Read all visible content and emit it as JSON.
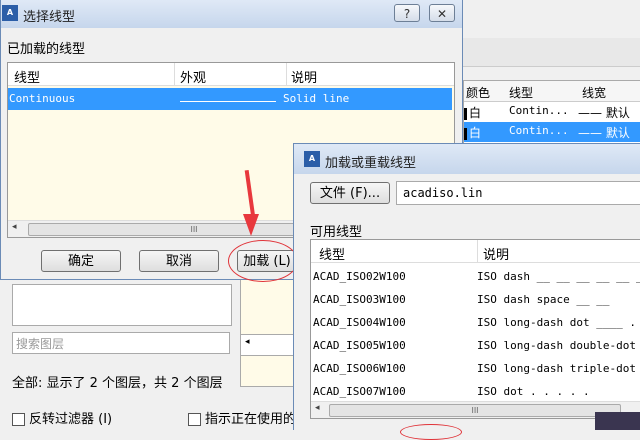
{
  "background_window": {
    "layer_table": {
      "headers": [
        "颜色",
        "线型",
        "线宽"
      ],
      "rows": [
        {
          "color": "白",
          "linetype": "Contin...",
          "lineweight": "—— 默认",
          "selected": false
        },
        {
          "color": "白",
          "linetype": "Contin...",
          "lineweight": "—— 默认",
          "selected": true
        }
      ]
    },
    "search_placeholder": "搜索图层",
    "status_text": "全部: 显示了 2 个图层，共 2 个图层",
    "invert_filter_label": "反转过滤器 (I)",
    "show_in_use_label": "指示正在使用的"
  },
  "select_linetype_dialog": {
    "title": "选择线型",
    "help_btn": "?",
    "close_btn": "✕",
    "loaded_label": "已加载的线型",
    "columns": [
      "线型",
      "外观",
      "说明"
    ],
    "rows": [
      {
        "name": "Continuous",
        "description": "Solid line"
      }
    ],
    "scroll_thumb": "III",
    "ok_label": "确定",
    "cancel_label": "取消",
    "load_label": "加载 (L)"
  },
  "load_reload_dialog": {
    "title": "加载或重载线型",
    "file_button": "文件 (F)...",
    "file_value": "acadiso.lin",
    "available_label": "可用线型",
    "columns": [
      "线型",
      "说明"
    ],
    "rows": [
      {
        "name": "ACAD_ISO02W100",
        "description": "ISO dash __ __ __ __ __ __"
      },
      {
        "name": "ACAD_ISO03W100",
        "description": "ISO dash space __    __"
      },
      {
        "name": "ACAD_ISO04W100",
        "description": "ISO long-dash dot ____ ."
      },
      {
        "name": "ACAD_ISO05W100",
        "description": "ISO long-dash double-dot"
      },
      {
        "name": "ACAD_ISO06W100",
        "description": "ISO long-dash triple-dot"
      },
      {
        "name": "ACAD_ISO07W100",
        "description": "ISO dot . . . . ."
      }
    ],
    "scroll_thumb": "III"
  },
  "colors": {
    "selection": "#3399ff",
    "annotation_red": "#e8383d",
    "list_bg": "#fffbe8"
  }
}
